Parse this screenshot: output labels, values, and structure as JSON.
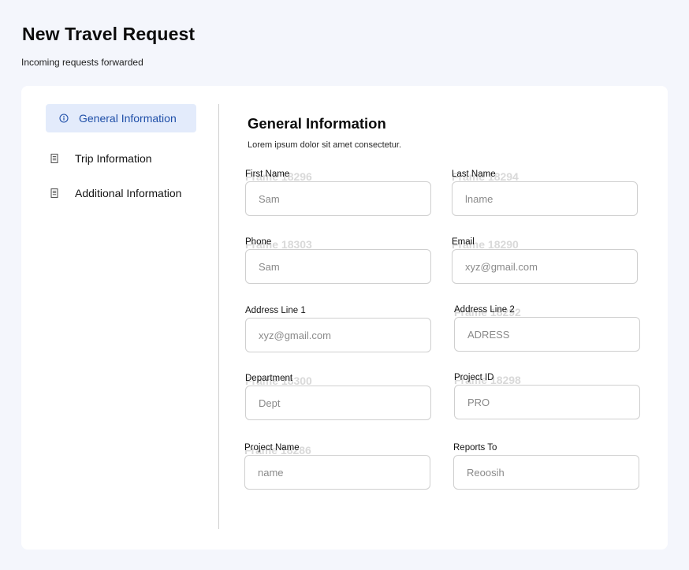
{
  "header": {
    "title": "New Travel Request",
    "subtitle": "Incoming requests forwarded"
  },
  "sidebar": {
    "items": [
      {
        "label": "General Information",
        "icon": "info-icon",
        "active": true
      },
      {
        "label": "Trip Information",
        "icon": "document-icon",
        "active": false
      },
      {
        "label": "Additional Information",
        "icon": "document-icon",
        "active": false
      }
    ]
  },
  "section": {
    "title": "General Information",
    "description": "Lorem ipsum dolor sit amet consectetur."
  },
  "fields": {
    "first_name": {
      "label": "First Name",
      "ghost": "Frame 18296",
      "placeholder": "Sam"
    },
    "last_name": {
      "label": "Last Name",
      "ghost": "Frame 18294",
      "placeholder": "lname"
    },
    "phone": {
      "label": "Phone",
      "ghost": "Frame 18303",
      "placeholder": "Sam"
    },
    "email": {
      "label": "Email",
      "ghost": "Frame 18290",
      "placeholder": "xyz@gmail.com"
    },
    "address_1": {
      "label": "Address Line 1",
      "ghost": "",
      "placeholder": "xyz@gmail.com"
    },
    "address_2": {
      "label": "Address Line 2",
      "ghost": "Frame 18292",
      "placeholder": "ADRESS"
    },
    "department": {
      "label": "Department",
      "ghost": "Frame 18300",
      "placeholder": "Dept"
    },
    "project_id": {
      "label": "Project ID",
      "ghost": "Frame 18298",
      "placeholder": "PRO"
    },
    "project_name": {
      "label": "Project Name",
      "ghost": "Frame 18286",
      "placeholder": "name"
    },
    "reports_to": {
      "label": "Reports To",
      "ghost": "",
      "placeholder": "Reoosih"
    }
  },
  "colors": {
    "background": "#f4f6fc",
    "active_nav_bg": "#e3ebfb",
    "active_nav_text": "#1f4fa8",
    "input_border": "#cfcfcf"
  }
}
